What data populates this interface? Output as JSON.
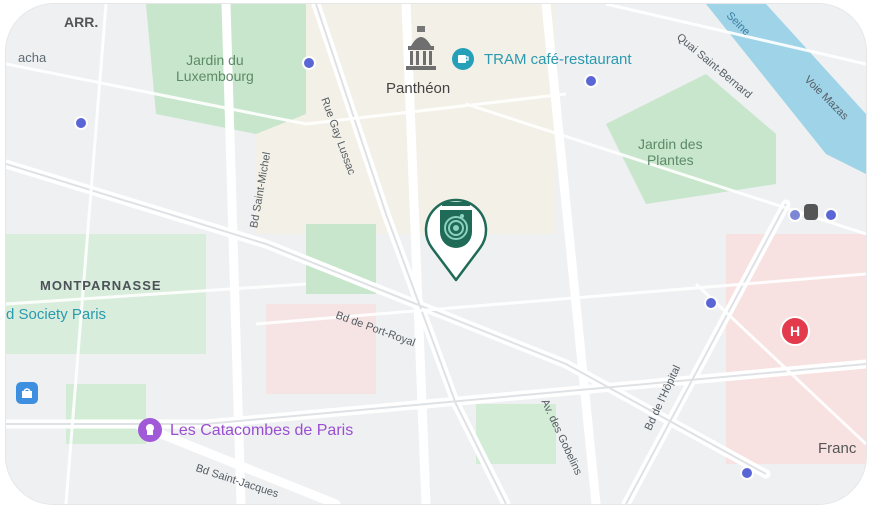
{
  "map": {
    "district_partial": "ARR.",
    "place_partial_left": "acha",
    "parks": {
      "luxembourg_line1": "Jardin du",
      "luxembourg_line2": "Luxembourg",
      "plantes_line1": "Jardin des",
      "plantes_line2": "Plantes"
    },
    "pois": {
      "pantheon": "Panthéon",
      "tram": "TRAM café-restaurant",
      "catacombes": "Les Catacombes de Paris",
      "society": "d Society Paris",
      "france_partial": "Franc"
    },
    "districts": {
      "montparnasse": "MONTPARNASSE"
    },
    "streets": {
      "bd_saint_michel": "Bd Saint-Michel",
      "rue_gay_lussac": "Rue Gay Lussac",
      "bd_port_royal": "Bd de Port-Royal",
      "av_gobelins": "Av. des Gobelins",
      "bd_hopital": "Bd de l'Hôpital",
      "bd_saint_jacques": "Bd Saint-Jacques",
      "quai_saint_bernard": "Quai Saint-Bernard",
      "voie_mazas": "Voie Mazas",
      "river_partial": "Seine"
    },
    "hospital_letter": "H",
    "colors": {
      "water": "#9ed3e8",
      "park": "#c7e6cc",
      "pin": "#1f6b57",
      "hospital": "#e33b4b",
      "poi_teal": "#26a0b9",
      "poi_purple": "#a05ad8"
    }
  }
}
